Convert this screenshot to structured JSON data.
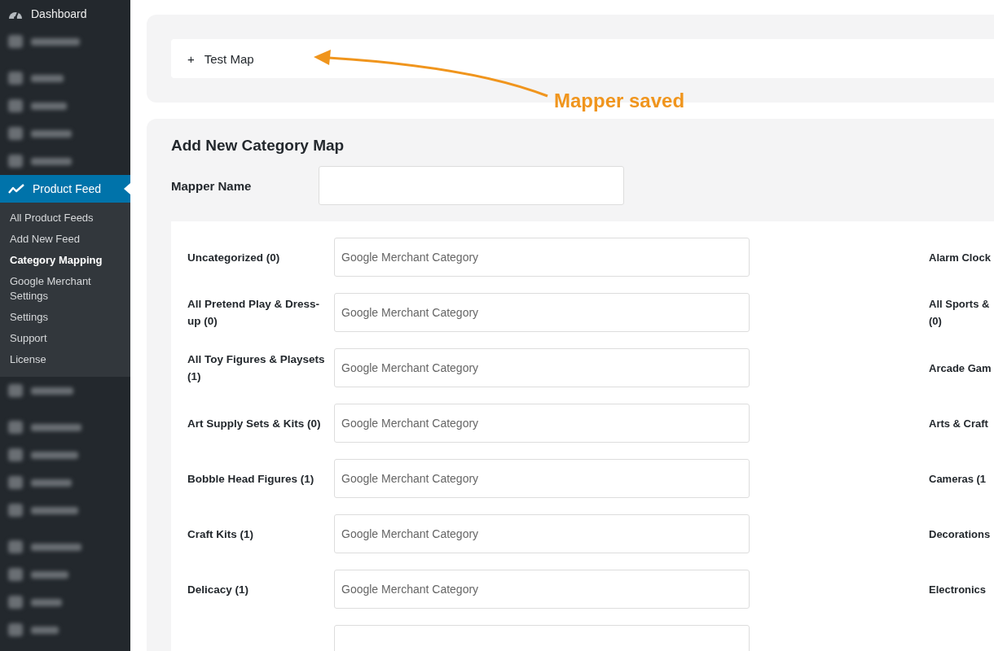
{
  "sidebar": {
    "items": [
      {
        "kind": "plain",
        "label": "Dashboard",
        "selected": false
      },
      {
        "kind": "blurred",
        "selected": false
      },
      {
        "kind": "gap"
      },
      {
        "kind": "blurred",
        "selected": false
      },
      {
        "kind": "blurred",
        "selected": false
      },
      {
        "kind": "blurred",
        "selected": false
      },
      {
        "kind": "blurred",
        "selected": false
      },
      {
        "kind": "current",
        "label": "Product Feed",
        "selected": true,
        "children": [
          {
            "label": "All Product Feeds",
            "selected": false
          },
          {
            "label": "Add New Feed",
            "selected": false
          },
          {
            "label": "Category Mapping",
            "selected": true
          },
          {
            "label": "Google Merchant Settings",
            "selected": false
          },
          {
            "label": "Settings",
            "selected": false
          },
          {
            "label": "Support",
            "selected": false
          },
          {
            "label": "License",
            "selected": false
          }
        ]
      },
      {
        "kind": "blurred",
        "selected": false
      },
      {
        "kind": "gap"
      },
      {
        "kind": "blurred",
        "selected": false
      },
      {
        "kind": "blurred",
        "selected": false
      },
      {
        "kind": "blurred",
        "selected": false
      },
      {
        "kind": "blurred",
        "selected": false
      },
      {
        "kind": "gap"
      },
      {
        "kind": "blurred",
        "selected": false
      },
      {
        "kind": "blurred",
        "selected": false
      },
      {
        "kind": "blurred",
        "selected": false
      },
      {
        "kind": "blurred",
        "selected": false
      }
    ]
  },
  "saved_maps": [
    {
      "toggle": "+",
      "label": "Test Map"
    }
  ],
  "annotation": {
    "text": "Mapper saved"
  },
  "form": {
    "title": "Add New Category Map",
    "name_label": "Mapper Name",
    "rows": [
      {
        "label": "Uncategorized (0)",
        "placeholder": "Google Merchant Category",
        "right": [
          "Alarm Clock"
        ]
      },
      {
        "label": "All Pretend Play & Dress-up (0)",
        "placeholder": "Google Merchant Category",
        "right": [
          "All Sports &",
          "(0)"
        ]
      },
      {
        "label": "All Toy Figures & Playsets (1)",
        "placeholder": "Google Merchant Category",
        "right": [
          "Arcade Gam"
        ]
      },
      {
        "label": "Art Supply Sets & Kits (0)",
        "placeholder": "Google Merchant Category",
        "right": [
          "Arts & Craft"
        ]
      },
      {
        "label": "Bobble Head Figures (1)",
        "placeholder": "Google Merchant Category",
        "right": [
          "Cameras (1"
        ]
      },
      {
        "label": "Craft Kits (1)",
        "placeholder": "Google Merchant Category",
        "right": [
          "Decorations"
        ]
      },
      {
        "label": "Delicacy (1)",
        "placeholder": "Google Merchant Category",
        "right": [
          "Electronics"
        ]
      },
      {}
    ]
  }
}
